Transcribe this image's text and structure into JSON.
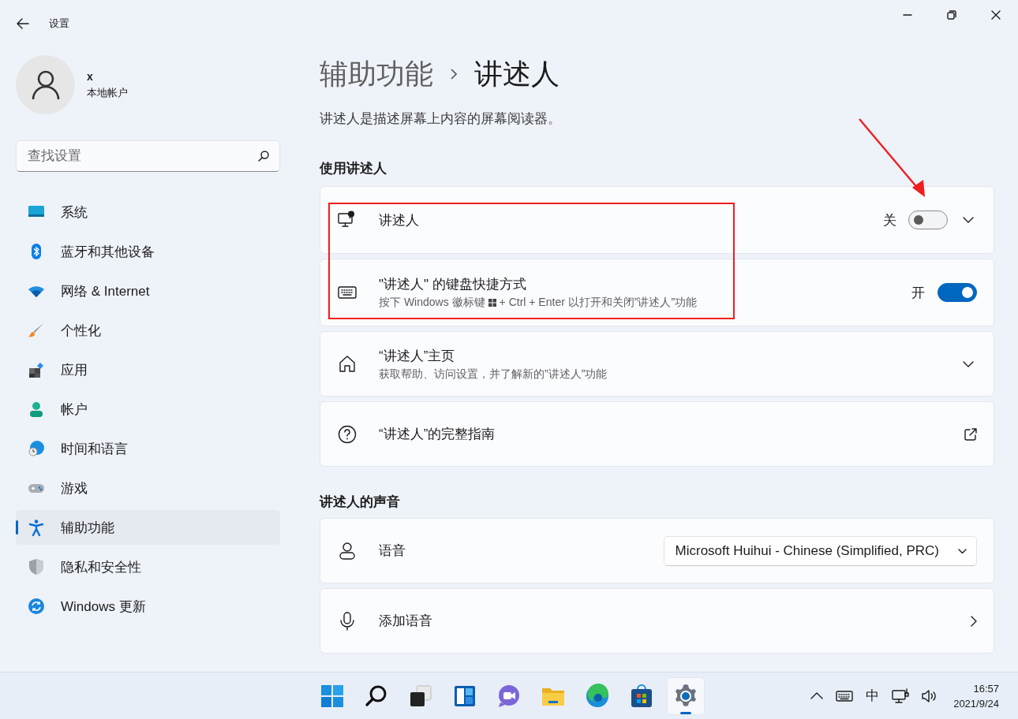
{
  "window": {
    "title": "设置"
  },
  "account": {
    "name": "x",
    "type": "本地帐户"
  },
  "search": {
    "placeholder": "查找设置"
  },
  "sidebar": {
    "items": [
      {
        "label": "系统",
        "selected": false
      },
      {
        "label": "蓝牙和其他设备",
        "selected": false
      },
      {
        "label": "网络 & Internet",
        "selected": false
      },
      {
        "label": "个性化",
        "selected": false
      },
      {
        "label": "应用",
        "selected": false
      },
      {
        "label": "帐户",
        "selected": false
      },
      {
        "label": "时间和语言",
        "selected": false
      },
      {
        "label": "游戏",
        "selected": false
      },
      {
        "label": "辅助功能",
        "selected": true
      },
      {
        "label": "隐私和安全性",
        "selected": false
      },
      {
        "label": "Windows 更新",
        "selected": false
      }
    ]
  },
  "breadcrumb": {
    "parent": "辅助功能",
    "current": "讲述人"
  },
  "description": "讲述人是描述屏幕上内容的屏幕阅读器。",
  "sections": [
    {
      "title": "使用讲述人",
      "cards": [
        {
          "kind": "toggle",
          "title": "讲述人",
          "state_label": "关",
          "on": false,
          "expanded": false
        },
        {
          "kind": "toggle",
          "title": "\"讲述人\" 的键盘快捷方式",
          "subtitle_parts": [
            "按下 Windows 徽标键",
            "+ Ctrl + Enter 以打开和关闭”讲述人”功能"
          ],
          "state_label": "开",
          "on": true
        },
        {
          "kind": "expand",
          "title": "“讲述人”主页",
          "subtitle": "获取帮助、访问设置，并了解新的”讲述人”功能",
          "expanded": false
        },
        {
          "kind": "link",
          "title": "“讲述人”的完整指南"
        }
      ]
    },
    {
      "title": "讲述人的声音",
      "cards": [
        {
          "kind": "dropdown",
          "title": "语音",
          "value": "Microsoft Huihui - Chinese (Simplified, PRC)"
        },
        {
          "kind": "nav",
          "title": "添加语音"
        }
      ]
    }
  ],
  "taskbar": {
    "items": [
      {
        "selected": false
      },
      {
        "selected": false
      },
      {
        "selected": false
      },
      {
        "selected": false
      },
      {
        "selected": false
      },
      {
        "selected": false
      },
      {
        "selected": false
      },
      {
        "selected": false
      },
      {
        "selected": true
      }
    ],
    "input_method": "中",
    "time": "16:57",
    "date": "2021/9/24"
  },
  "annotations": [
    {
      "kind": "box"
    },
    {
      "kind": "arrow"
    }
  ]
}
